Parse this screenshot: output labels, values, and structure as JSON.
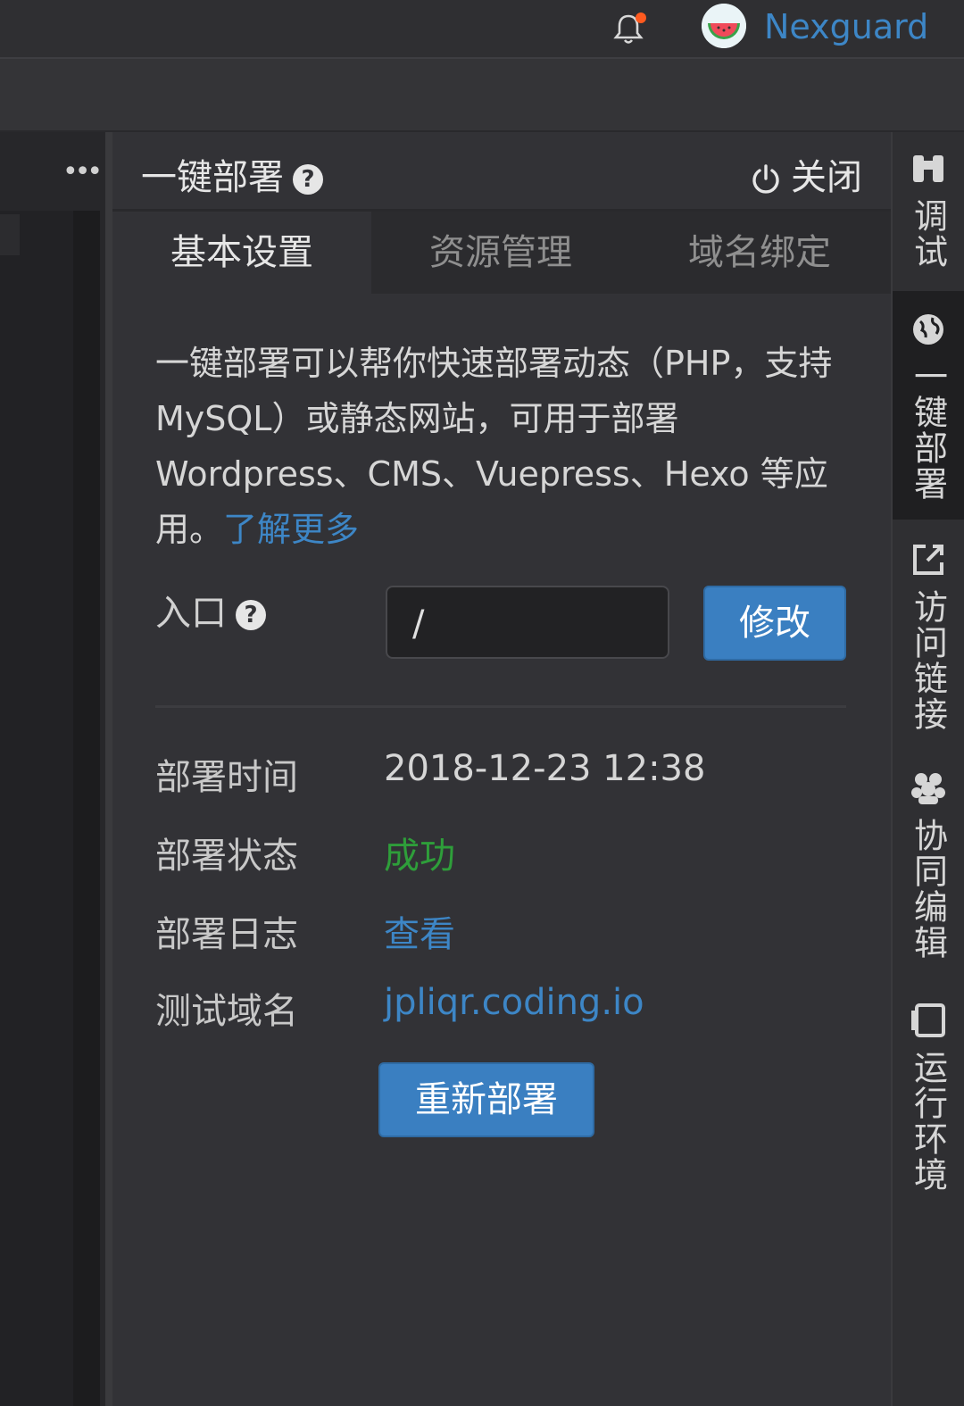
{
  "topbar": {
    "username": "Nexguard",
    "notification_dot_color": "#ff5a1f"
  },
  "left_pane": {
    "more_label": "•••"
  },
  "panel": {
    "title": "一键部署",
    "help_icon": "?",
    "close_label": "关闭",
    "tabs": [
      {
        "label": "基本设置",
        "active": true
      },
      {
        "label": "资源管理",
        "active": false
      },
      {
        "label": "域名绑定",
        "active": false
      }
    ],
    "description": "一键部署可以帮你快速部署动态（PHP，支持 MySQL）或静态网站，可用于部署 Wordpress、CMS、Vuepress、Hexo 等应用。",
    "learn_more": "了解更多",
    "entry": {
      "label": "入口",
      "help_icon": "?",
      "value": "/",
      "modify_label": "修改"
    },
    "info": {
      "deploy_time_label": "部署时间",
      "deploy_time_value": "2018-12-23 12:38",
      "deploy_status_label": "部署状态",
      "deploy_status_value": "成功",
      "deploy_log_label": "部署日志",
      "deploy_log_value": "查看",
      "test_domain_label": "测试域名",
      "test_domain_value": "jpliqr.coding.io"
    },
    "redeploy_label": "重新部署"
  },
  "right_sidebar": {
    "items": [
      {
        "label": "调试",
        "icon": "bug-icon"
      },
      {
        "label": "一键部署",
        "icon": "globe-icon",
        "active": true
      },
      {
        "label": "访问链接",
        "icon": "external-link-icon"
      },
      {
        "label": "协同编辑",
        "icon": "users-icon"
      },
      {
        "label": "运行环境",
        "icon": "laptop-icon"
      }
    ]
  },
  "colors": {
    "accent": "#3a7fc1",
    "link": "#3d86c6",
    "success": "#2e9e3a",
    "background": "#323236"
  }
}
